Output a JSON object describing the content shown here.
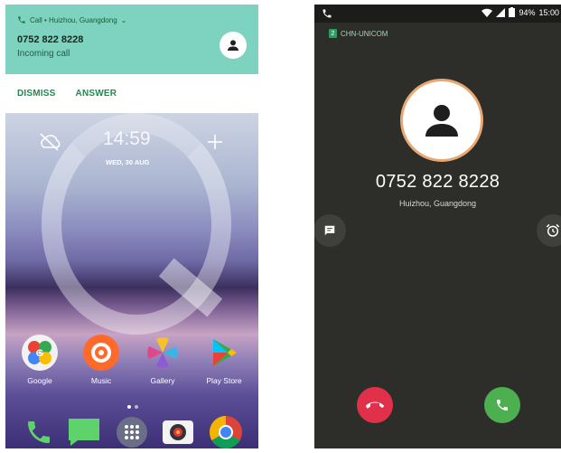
{
  "left_screen": {
    "notification": {
      "header": "Call • Huizhou, Guangdong",
      "number": "0752 822 8228",
      "subtitle": "Incoming call",
      "dismiss_label": "DISMISS",
      "answer_label": "ANSWER"
    },
    "lock_widget": {
      "time": "14:59",
      "date": "WED, 30 AUG"
    },
    "apps": [
      {
        "label": "Google",
        "icon": "google-folder-icon"
      },
      {
        "label": "Music",
        "icon": "music-icon"
      },
      {
        "label": "Gallery",
        "icon": "gallery-icon"
      },
      {
        "label": "Play Store",
        "icon": "play-store-icon"
      }
    ],
    "dock": [
      "phone-icon",
      "messages-icon",
      "app-drawer-icon",
      "camera-icon",
      "chrome-icon"
    ]
  },
  "right_screen": {
    "status_bar": {
      "battery": "94%",
      "time": "15:00"
    },
    "carrier": {
      "sim": "2",
      "name": "CHN-UNICOM"
    },
    "caller": {
      "number": "0752 822 8228",
      "location": "Huizhou, Guangdong"
    }
  },
  "colors": {
    "notification_bg": "#7ed3c0",
    "action_green": "#1f8a4c",
    "incall_bg": "#2d2d2a",
    "decline_red": "#e0304a",
    "accept_green": "#4caf50",
    "avatar_ring": "#e8a871"
  }
}
